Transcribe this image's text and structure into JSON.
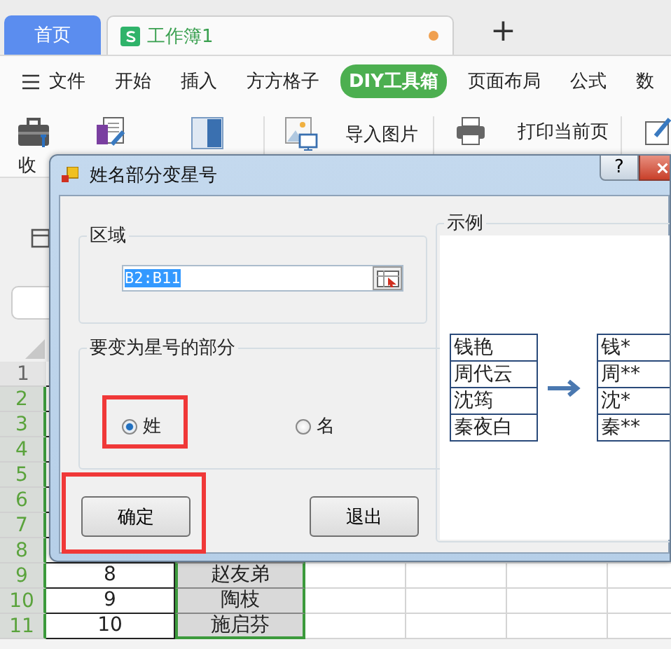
{
  "tabs": [
    {
      "label": "首页",
      "selected": false,
      "kind": "home"
    },
    {
      "label": "工作簿1",
      "selected": true,
      "kind": "sheet",
      "unsaved": true
    }
  ],
  "new_tab": "+",
  "menu": [
    {
      "label": "文件",
      "selected": false,
      "kind": "file"
    },
    {
      "label": "开始",
      "selected": false
    },
    {
      "label": "插入",
      "selected": false
    },
    {
      "label": "方方格子",
      "selected": false
    },
    {
      "label": "DIY工具箱",
      "selected": true
    },
    {
      "label": "页面布局",
      "selected": false
    },
    {
      "label": "公式",
      "selected": false
    },
    {
      "label": "数",
      "selected": false
    }
  ],
  "toolbar": [
    {
      "kind": "briefcase",
      "label": "收"
    },
    {
      "kind": "document"
    },
    {
      "kind": "panel"
    },
    {
      "kind": "image",
      "label": "导入图片"
    },
    {
      "kind": "printer",
      "label": "打印当前页"
    },
    {
      "kind": "pen"
    }
  ],
  "sheet": {
    "rows": [
      {
        "number": "1",
        "selected": false
      },
      {
        "number": "2",
        "selected": true
      },
      {
        "number": "3",
        "selected": true
      },
      {
        "number": "4",
        "selected": true
      },
      {
        "number": "5",
        "selected": true
      },
      {
        "number": "6",
        "selected": true
      },
      {
        "number": "7",
        "selected": true
      },
      {
        "number": "8",
        "selected": true
      },
      {
        "number": "9",
        "selected": true,
        "cells": [
          "8",
          "赵友弟"
        ]
      },
      {
        "number": "10",
        "selected": true,
        "cells": [
          "9",
          "陶枝"
        ]
      },
      {
        "number": "11",
        "selected": true,
        "cells": [
          "10",
          "施启芬"
        ]
      }
    ]
  },
  "dialog": {
    "title": "姓名部分变星号",
    "help": "?",
    "range": {
      "label": "区域",
      "value": "B2:B11"
    },
    "part": {
      "label": "要变为星号的部分",
      "options": [
        {
          "label": "姓",
          "selected": true,
          "highlighted": true
        },
        {
          "label": "名",
          "selected": false,
          "highlighted": false
        }
      ]
    },
    "buttons": [
      {
        "label": "确定",
        "highlighted": true
      },
      {
        "label": "退出",
        "highlighted": false
      }
    ],
    "example": {
      "label": "示例",
      "before": [
        "钱艳",
        "周代云",
        "沈筠",
        "秦夜白"
      ],
      "after": [
        "钱*",
        "周**",
        "沈*",
        "秦**"
      ]
    }
  }
}
